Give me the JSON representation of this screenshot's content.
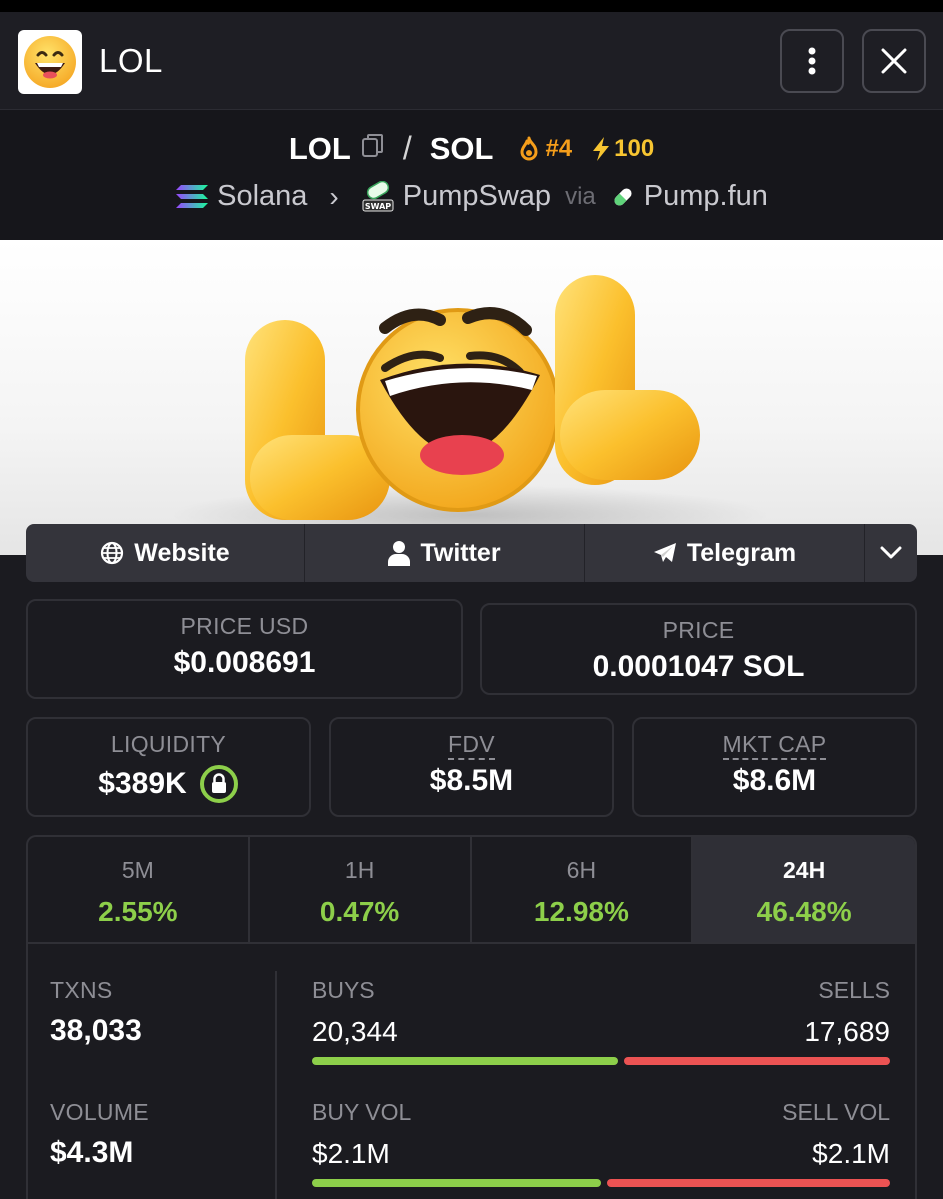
{
  "header": {
    "title": "LOL",
    "avatar_icon": "grinning-face-emoji",
    "more_icon": "vertical-dots-icon",
    "close_icon": "close-icon"
  },
  "pair": {
    "base": "LOL",
    "quote": "SOL",
    "rank": "#4",
    "boost": "100",
    "chain": "Solana",
    "dex": "PumpSwap",
    "via_label": "via",
    "launchpad": "Pump.fun",
    "colors": {
      "rank": "#f59e1b",
      "boost": "#f7c531"
    }
  },
  "banner": {
    "text": "LOL"
  },
  "links": {
    "website": "Website",
    "twitter": "Twitter",
    "telegram": "Telegram"
  },
  "stats": {
    "price_usd_label": "PRICE USD",
    "price_usd": "$0.008691",
    "price_label": "PRICE",
    "price": "0.0001047 SOL",
    "liquidity_label": "LIQUIDITY",
    "liquidity": "$389K",
    "fdv_label": "FDV",
    "fdv": "$8.5M",
    "mkt_cap_label": "MKT CAP",
    "mkt_cap": "$8.6M"
  },
  "timeframes": [
    {
      "label": "5M",
      "change": "2.55%"
    },
    {
      "label": "1H",
      "change": "0.47%"
    },
    {
      "label": "6H",
      "change": "12.98%"
    },
    {
      "label": "24H",
      "change": "46.48%"
    }
  ],
  "active_timeframe": "24H",
  "txns": {
    "txns_label": "TXNS",
    "txns": "38,033",
    "buys_label": "BUYS",
    "buys": "20,344",
    "sells_label": "SELLS",
    "sells": "17,689",
    "buys_fraction": 0.535,
    "volume_label": "VOLUME",
    "volume": "$4.3M",
    "buy_vol_label": "BUY VOL",
    "buy_vol": "$2.1M",
    "sell_vol_label": "SELL VOL",
    "sell_vol": "$2.1M",
    "buy_vol_fraction": 0.505
  },
  "colors": {
    "positive": "#8dcf4a",
    "negative": "#ec5353",
    "background": "#1b1b20"
  }
}
